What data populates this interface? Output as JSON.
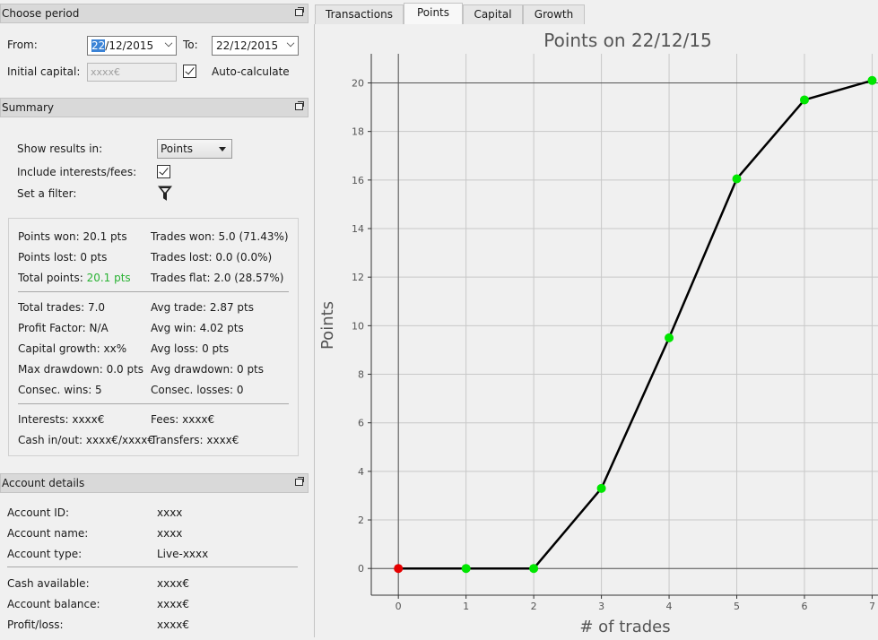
{
  "period": {
    "header": "Choose period",
    "from_label": "From:",
    "from_value_sel": "22",
    "from_value_rest": "/12/2015",
    "to_label": "To:",
    "to_value": "22/12/2015",
    "capital_label": "Initial capital:",
    "capital_placeholder": "xxxx€",
    "auto_label": "Auto-calculate"
  },
  "summary": {
    "header": "Summary",
    "show_label": "Show results in:",
    "show_value": "Points",
    "include_label": "Include interests/fees:",
    "filter_label": "Set a filter:",
    "points_won": "Points won: 20.1 pts",
    "points_lost": "Points lost: 0 pts",
    "total_points_label": "Total points: ",
    "total_points_value": "20.1 pts",
    "trades_won": "Trades won: 5.0 (71.43%)",
    "trades_lost": "Trades lost: 0.0 (0.0%)",
    "trades_flat": "Trades flat: 2.0 (28.57%)",
    "total_trades": "Total trades: 7.0",
    "profit_factor": "Profit Factor: N/A",
    "capital_growth": "Capital growth: xx%",
    "max_drawdown": "Max drawdown: 0.0 pts",
    "consec_wins": "Consec. wins: 5",
    "avg_trade": "Avg trade: 2.87 pts",
    "avg_win": "Avg win: 4.02 pts",
    "avg_loss": "Avg loss: 0 pts",
    "avg_drawdown": "Avg drawdown: 0 pts",
    "consec_losses": "Consec. losses: 0",
    "interests": "Interests: xxxx€",
    "cash_inout": "Cash in/out: xxxx€/xxxx€",
    "fees": "Fees: xxxx€",
    "transfers": "Transfers: xxxx€"
  },
  "account": {
    "header": "Account details",
    "id_label": "Account ID:",
    "id_value": "xxxx",
    "name_label": "Account name:",
    "name_value": "xxxx",
    "type_label": "Account type:",
    "type_value": "Live-xxxx",
    "cash_label": "Cash available:",
    "cash_value": "xxxx€",
    "balance_label": "Account balance:",
    "balance_value": "xxxx€",
    "pl_label": "Profit/loss:",
    "pl_value": "xxxx€"
  },
  "tabs": [
    "Transactions",
    "Points",
    "Capital",
    "Growth"
  ],
  "active_tab": "Points",
  "colors": {
    "accent_green": "#29b233",
    "point_green": "#00e600",
    "point_red": "#e60000",
    "line": "#000000"
  },
  "icons": {
    "filter": "funnel-icon",
    "float": "float-window-icon"
  },
  "chart_data": {
    "type": "line",
    "title": "Points on 22/12/15",
    "xlabel": "# of trades",
    "ylabel": "Points",
    "x": [
      0,
      1,
      2,
      3,
      4,
      5,
      6,
      7
    ],
    "series": [
      {
        "values": [
          0,
          0,
          0,
          3.3,
          9.5,
          16.05,
          19.3,
          20.1
        ]
      }
    ],
    "point_colors": [
      "red",
      "green",
      "green",
      "green",
      "green",
      "green",
      "green",
      "green"
    ],
    "xlim": [
      -0.4,
      7.1
    ],
    "ylim": [
      -1.1,
      21.2
    ],
    "xticks": [
      0,
      1,
      2,
      3,
      4,
      5,
      6,
      7
    ],
    "yticks": [
      0,
      2,
      4,
      6,
      8,
      10,
      12,
      14,
      16,
      18,
      20
    ],
    "grid": true
  }
}
